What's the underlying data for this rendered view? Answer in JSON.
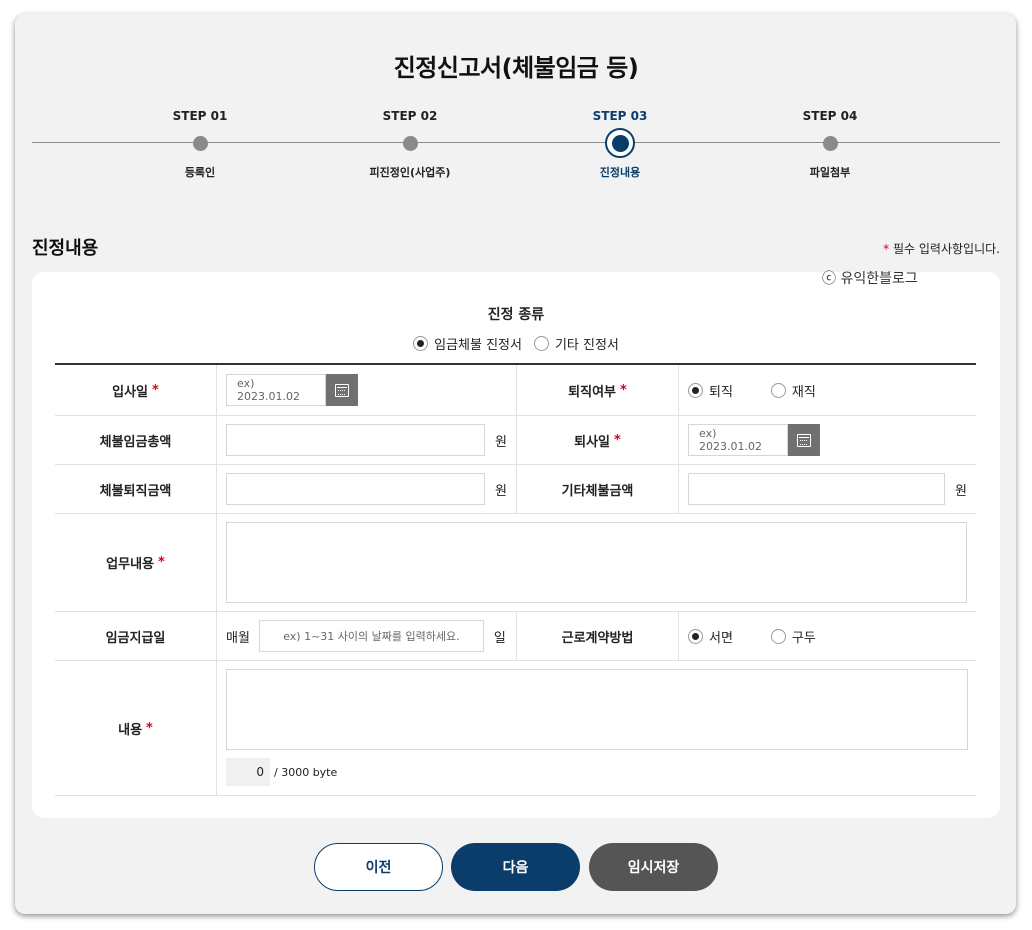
{
  "page_title": "진정신고서(체불임금 등)",
  "steps": [
    {
      "label": "STEP 01",
      "name": "등록인",
      "active": false
    },
    {
      "label": "STEP 02",
      "name": "피진정인(사업주)",
      "active": false
    },
    {
      "label": "STEP 03",
      "name": "진정내용",
      "active": true
    },
    {
      "label": "STEP 04",
      "name": "파일첨부",
      "active": false
    }
  ],
  "section_title": "진정내용",
  "required_note": {
    "star": "*",
    "text": "필수 입력사항입니다."
  },
  "watermark": "ⓒ 유익한블로그",
  "petition_type": {
    "title": "진정 종류",
    "options": [
      "임금체불 진정서",
      "기타 진정서"
    ],
    "selected": "임금체불 진정서"
  },
  "form": {
    "hire_date": {
      "label": "입사일",
      "placeholder": "ex) 2023.01.02"
    },
    "retired": {
      "label": "퇴직여부",
      "options": [
        "퇴직",
        "재직"
      ],
      "selected": "퇴직"
    },
    "unpaid_total": {
      "label": "체불임금총액",
      "value": "",
      "unit": "원"
    },
    "leave_date": {
      "label": "퇴사일",
      "placeholder": "ex) 2023.01.02"
    },
    "unpaid_severance": {
      "label": "체불퇴직금액",
      "value": "",
      "unit": "원"
    },
    "other_unpaid": {
      "label": "기타체불금액",
      "value": "",
      "unit": "원"
    },
    "job_description": {
      "label": "업무내용",
      "value": ""
    },
    "pay_day": {
      "label": "임금지급일",
      "prefix": "매월",
      "placeholder": "ex) 1~31 사이의 날짜를 입력하세요.",
      "suffix": "일"
    },
    "contract_method": {
      "label": "근로계약방법",
      "options": [
        "서면",
        "구두"
      ],
      "selected": "서면"
    },
    "content": {
      "label": "내용",
      "value": "",
      "byte_count": "0",
      "byte_limit": "/ 3000 byte"
    },
    "required_mark": "*"
  },
  "buttons": {
    "prev": "이전",
    "next": "다음",
    "save": "임시저장"
  },
  "colors": {
    "primary": "#0b3d6b",
    "required": "#d0021b",
    "save": "#555555"
  }
}
